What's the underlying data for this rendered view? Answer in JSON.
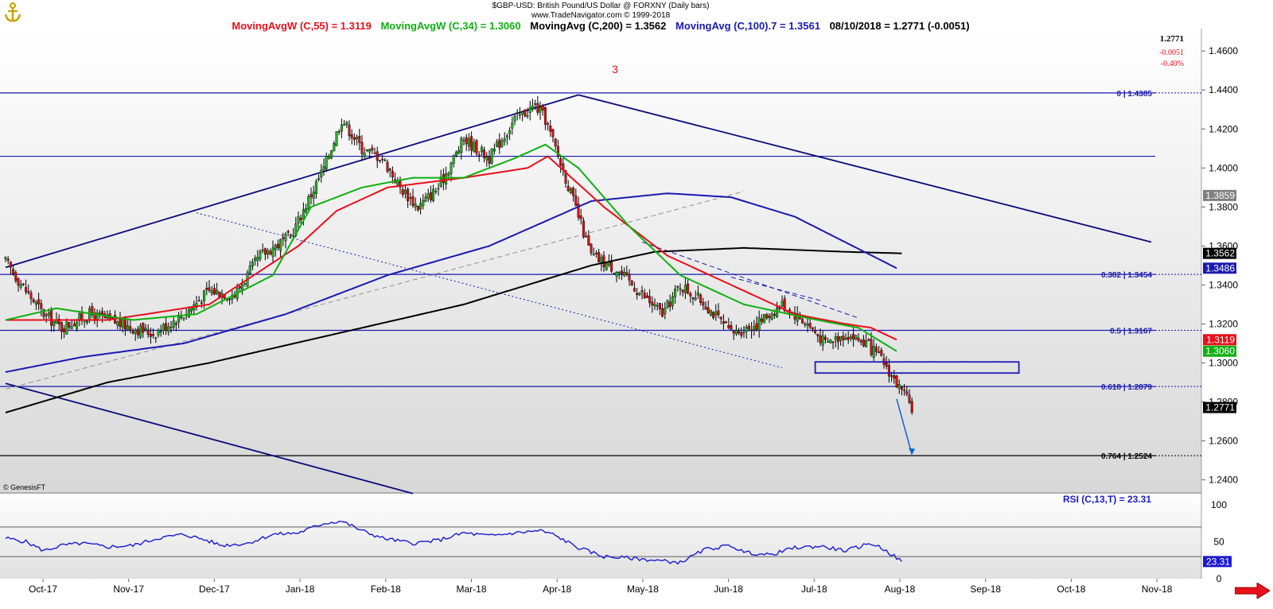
{
  "header": {
    "title": "$GBP-USD:  British Pound/US Dollar @ FORXNY  (Daily bars)",
    "site": "www.TradeNavigator.com © 1999-2018",
    "indicators": [
      {
        "text": "MovingAvgW (C,55) = 1.3119",
        "color": "#e8101b"
      },
      {
        "text": "MovingAvgW (C,34) = 1.3060",
        "color": "#10b010"
      },
      {
        "text": "MovingAvg (C,200) = 1.3562",
        "color": "#000000"
      },
      {
        "text": "MovingAvg (C,100).7 = 1.3561",
        "color": "#1a1ab0"
      },
      {
        "text": "08/10/2018 = 1.2771 (-0.0051)",
        "color": "#000000"
      }
    ]
  },
  "quote": {
    "last": "1.2771",
    "change": "-0.0051",
    "pct": "-0.40%"
  },
  "wave_label": "3",
  "copyright": "© GenesisFT",
  "rsi_label": "RSI (C,13,T) = 23.31",
  "colors": {
    "ma55": "#e8101b",
    "ma34": "#10b010",
    "ma200": "#000000",
    "ma100": "#1a1ab0",
    "rsi": "#1a1ad0",
    "fib": "#1a1ab0",
    "trend": "#0a0a7a"
  },
  "chart_data": {
    "type": "candlestick",
    "title": "$GBP-USD:  British Pound/US Dollar @ FORXNY  (Daily bars)",
    "x_labels": [
      "Oct-17",
      "Nov-17",
      "Dec-17",
      "Jan-18",
      "Feb-18",
      "Mar-18",
      "Apr-18",
      "May-18",
      "Jun-18",
      "Jul-18",
      "Aug-18",
      "Sep-18",
      "Oct-18",
      "Nov-18"
    ],
    "y_ticks": [
      "1.4600",
      "1.4400",
      "1.4200",
      "1.4000",
      "1.3800",
      "1.3600",
      "1.3400",
      "1.3200",
      "1.3000",
      "1.2800",
      "1.2600",
      "1.2400"
    ],
    "ylim": [
      1.2337,
      1.4715
    ],
    "fib_levels": [
      {
        "label": "0 | 1.4385",
        "value": 1.4385
      },
      {
        "label": "0.382 | 1.3454",
        "value": 1.3454
      },
      {
        "label": "0.5 | 1.3167",
        "value": 1.3167
      },
      {
        "label": "0.618 | 1.2879",
        "value": 1.2879
      },
      {
        "label": "0.764 | 1.2524",
        "value": 1.2524
      }
    ],
    "horizontal_line": 1.406,
    "value_tags": [
      {
        "text": "1.3859",
        "value": 1.3859,
        "bg": "#808080"
      },
      {
        "text": "1.3562",
        "value": 1.3562,
        "bg": "#000000"
      },
      {
        "text": "1.3486",
        "value": 1.3486,
        "bg": "#1a1ab0"
      },
      {
        "text": "1.3119",
        "value": 1.3119,
        "bg": "#e8101b"
      },
      {
        "text": "1.3060",
        "value": 1.306,
        "bg": "#10b010"
      },
      {
        "text": "1.2771",
        "value": 1.2771,
        "bg": "#000000"
      }
    ],
    "path_anchors": [
      [
        0,
        1.352
      ],
      [
        8,
        1.337
      ],
      [
        15,
        1.325
      ],
      [
        22,
        1.318
      ],
      [
        33,
        1.325
      ],
      [
        45,
        1.32
      ],
      [
        58,
        1.315
      ],
      [
        70,
        1.325
      ],
      [
        80,
        1.337
      ],
      [
        90,
        1.335
      ],
      [
        100,
        1.355
      ],
      [
        112,
        1.365
      ],
      [
        125,
        1.4
      ],
      [
        132,
        1.425
      ],
      [
        140,
        1.41
      ],
      [
        148,
        1.405
      ],
      [
        155,
        1.39
      ],
      [
        162,
        1.38
      ],
      [
        170,
        1.39
      ],
      [
        180,
        1.415
      ],
      [
        190,
        1.405
      ],
      [
        200,
        1.425
      ],
      [
        208,
        1.432
      ],
      [
        212,
        1.425
      ],
      [
        220,
        1.395
      ],
      [
        225,
        1.375
      ],
      [
        230,
        1.355
      ],
      [
        240,
        1.348
      ],
      [
        250,
        1.335
      ],
      [
        258,
        1.325
      ],
      [
        265,
        1.34
      ],
      [
        275,
        1.33
      ],
      [
        285,
        1.315
      ],
      [
        295,
        1.32
      ],
      [
        305,
        1.33
      ],
      [
        315,
        1.32
      ],
      [
        322,
        1.31
      ],
      [
        330,
        1.315
      ],
      [
        338,
        1.31
      ],
      [
        345,
        1.3
      ],
      [
        352,
        1.285
      ],
      [
        356,
        1.2771
      ]
    ],
    "ma55_anchors": [
      [
        0,
        1.322
      ],
      [
        40,
        1.322
      ],
      [
        80,
        1.33
      ],
      [
        115,
        1.36
      ],
      [
        130,
        1.378
      ],
      [
        150,
        1.39
      ],
      [
        180,
        1.395
      ],
      [
        205,
        1.4
      ],
      [
        213,
        1.406
      ],
      [
        235,
        1.38
      ],
      [
        260,
        1.355
      ],
      [
        285,
        1.34
      ],
      [
        310,
        1.325
      ],
      [
        330,
        1.32
      ],
      [
        340,
        1.318
      ],
      [
        350,
        1.3119
      ]
    ],
    "ma34_anchors": [
      [
        0,
        1.322
      ],
      [
        20,
        1.328
      ],
      [
        50,
        1.322
      ],
      [
        75,
        1.325
      ],
      [
        90,
        1.335
      ],
      [
        105,
        1.345
      ],
      [
        120,
        1.38
      ],
      [
        140,
        1.39
      ],
      [
        160,
        1.395
      ],
      [
        180,
        1.395
      ],
      [
        200,
        1.405
      ],
      [
        212,
        1.412
      ],
      [
        225,
        1.4
      ],
      [
        245,
        1.37
      ],
      [
        265,
        1.345
      ],
      [
        290,
        1.33
      ],
      [
        315,
        1.323
      ],
      [
        335,
        1.318
      ],
      [
        350,
        1.306
      ]
    ],
    "ma200_anchors": [
      [
        0,
        1.2745
      ],
      [
        40,
        1.29
      ],
      [
        80,
        1.3
      ],
      [
        130,
        1.315
      ],
      [
        180,
        1.33
      ],
      [
        230,
        1.35
      ],
      [
        255,
        1.357
      ],
      [
        290,
        1.359
      ],
      [
        330,
        1.357
      ],
      [
        352,
        1.3562
      ]
    ],
    "ma100_anchors": [
      [
        0,
        1.2953
      ],
      [
        30,
        1.303
      ],
      [
        70,
        1.31
      ],
      [
        110,
        1.325
      ],
      [
        150,
        1.345
      ],
      [
        190,
        1.36
      ],
      [
        230,
        1.383
      ],
      [
        260,
        1.387
      ],
      [
        285,
        1.385
      ],
      [
        310,
        1.375
      ],
      [
        350,
        1.3486
      ]
    ],
    "trendlines": [
      {
        "from": [
          0,
          1.349
        ],
        "to": [
          225,
          1.4375
        ]
      },
      {
        "from": [
          225,
          1.4375
        ],
        "to": [
          450,
          1.362
        ]
      },
      {
        "from": [
          0,
          1.2895
        ],
        "to": [
          160,
          1.233
        ]
      }
    ],
    "dotted_line": {
      "from": [
        75,
        1.377
      ],
      "to": [
        305,
        1.2975
      ]
    },
    "dashed_line": {
      "from": [
        0,
        1.2865
      ],
      "to": [
        290,
        1.388
      ]
    },
    "dashed_channel": [
      {
        "from": [
          250,
          1.362
        ],
        "to": [
          335,
          1.323
        ]
      },
      {
        "from": [
          285,
          1.344
        ],
        "to": [
          320,
          1.332
        ]
      }
    ],
    "target_box": {
      "x0": 318,
      "x1": 398,
      "top": 1.3005,
      "bottom": 1.2948
    },
    "projection_arrow": {
      "from": [
        350,
        1.2815
      ],
      "to": [
        356,
        1.253
      ]
    },
    "rsi": {
      "label": "RSI (C,13,T) = 23.31",
      "y_ticks": [
        "100",
        "50",
        "0"
      ],
      "levels": [
        70,
        30
      ],
      "last": "23.31",
      "anchors": [
        [
          0,
          55
        ],
        [
          8,
          50
        ],
        [
          15,
          38
        ],
        [
          22,
          45
        ],
        [
          30,
          48
        ],
        [
          40,
          43
        ],
        [
          50,
          45
        ],
        [
          60,
          55
        ],
        [
          70,
          60
        ],
        [
          78,
          53
        ],
        [
          85,
          45
        ],
        [
          95,
          48
        ],
        [
          105,
          60
        ],
        [
          115,
          62
        ],
        [
          125,
          75
        ],
        [
          132,
          78
        ],
        [
          140,
          65
        ],
        [
          148,
          55
        ],
        [
          160,
          48
        ],
        [
          170,
          52
        ],
        [
          180,
          62
        ],
        [
          190,
          58
        ],
        [
          200,
          62
        ],
        [
          210,
          65
        ],
        [
          215,
          60
        ],
        [
          225,
          42
        ],
        [
          235,
          30
        ],
        [
          245,
          28
        ],
        [
          255,
          25
        ],
        [
          265,
          22
        ],
        [
          275,
          40
        ],
        [
          285,
          45
        ],
        [
          290,
          36
        ],
        [
          300,
          32
        ],
        [
          310,
          42
        ],
        [
          320,
          44
        ],
        [
          330,
          38
        ],
        [
          340,
          48
        ],
        [
          345,
          40
        ],
        [
          352,
          23.31
        ]
      ]
    }
  }
}
